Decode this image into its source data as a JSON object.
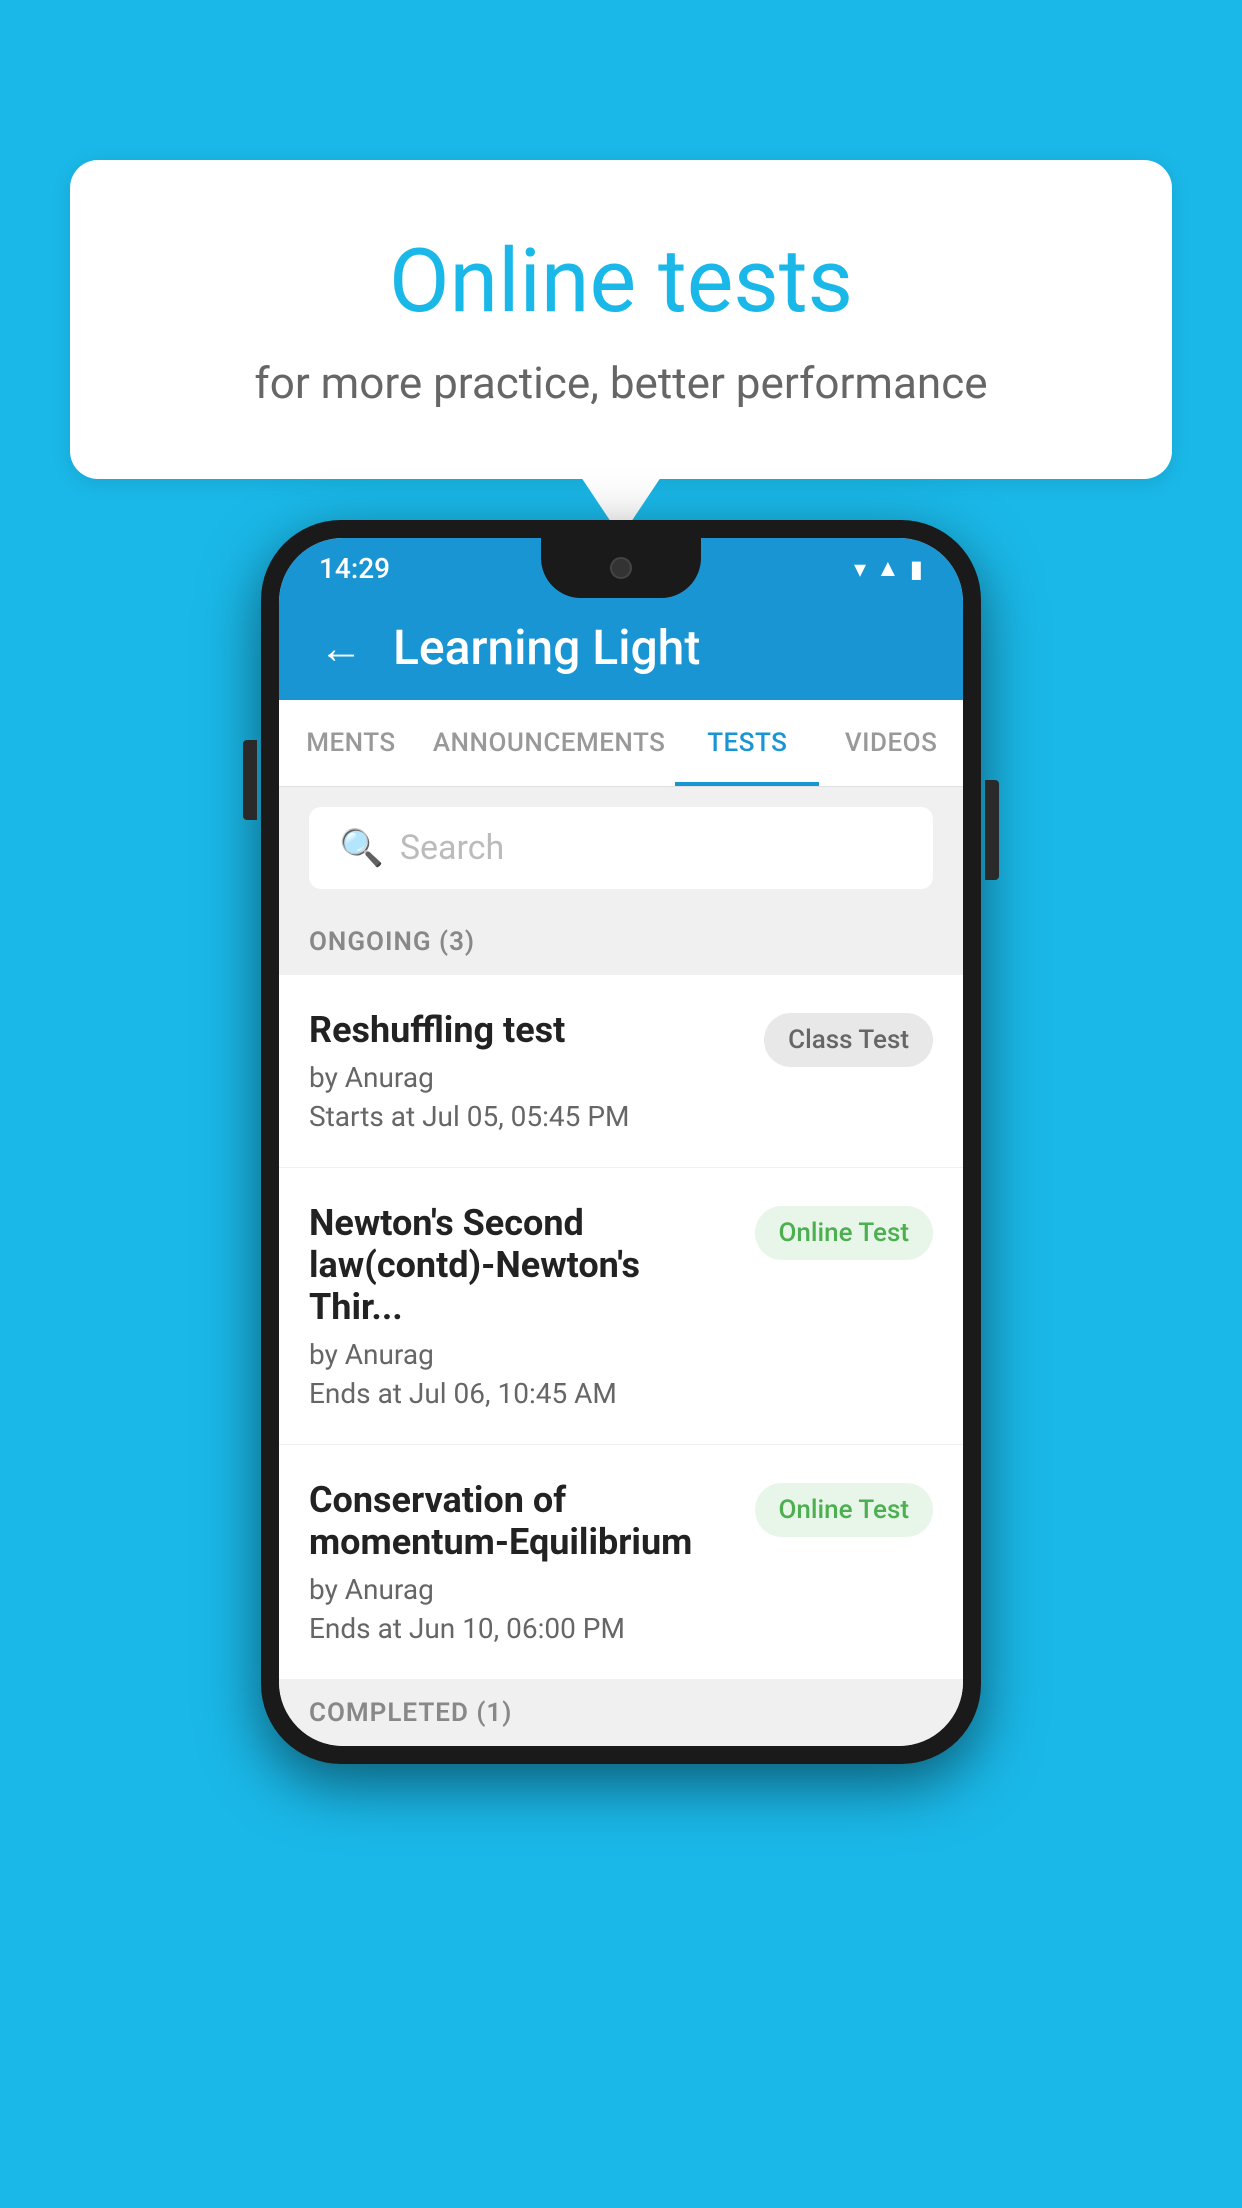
{
  "background": {
    "color": "#1ab8e8"
  },
  "speech_bubble": {
    "title": "Online tests",
    "subtitle": "for more practice, better performance"
  },
  "status_bar": {
    "time": "14:29",
    "icons": [
      "wifi",
      "signal",
      "battery"
    ]
  },
  "app_header": {
    "back_label": "←",
    "title": "Learning Light"
  },
  "tabs": [
    {
      "label": "MENTS",
      "active": false
    },
    {
      "label": "ANNOUNCEMENTS",
      "active": false
    },
    {
      "label": "TESTS",
      "active": true
    },
    {
      "label": "VIDEOS",
      "active": false
    }
  ],
  "search": {
    "placeholder": "Search"
  },
  "ongoing_section": {
    "label": "ONGOING (3)"
  },
  "tests": [
    {
      "name": "Reshuffling test",
      "by": "by Anurag",
      "time": "Starts at  Jul 05, 05:45 PM",
      "badge": "Class Test",
      "badge_type": "class"
    },
    {
      "name": "Newton's Second law(contd)-Newton's Thir...",
      "by": "by Anurag",
      "time": "Ends at  Jul 06, 10:45 AM",
      "badge": "Online Test",
      "badge_type": "online"
    },
    {
      "name": "Conservation of momentum-Equilibrium",
      "by": "by Anurag",
      "time": "Ends at  Jun 10, 06:00 PM",
      "badge": "Online Test",
      "badge_type": "online"
    }
  ],
  "completed_section": {
    "label": "COMPLETED (1)"
  }
}
